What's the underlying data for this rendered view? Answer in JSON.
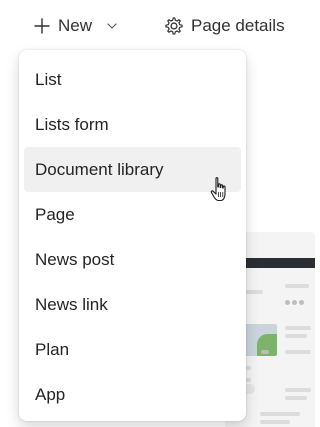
{
  "command_bar": {
    "new_label": "New",
    "details_label": "Page details",
    "icons": [
      "plus-icon",
      "chevron-down-icon",
      "gear-icon"
    ]
  },
  "menu": {
    "items": [
      {
        "label": "List"
      },
      {
        "label": "Lists form"
      },
      {
        "label": "Document library",
        "hovered": true
      },
      {
        "label": "Page"
      },
      {
        "label": "News post"
      },
      {
        "label": "News link"
      },
      {
        "label": "Plan"
      },
      {
        "label": "App"
      }
    ]
  },
  "colors": {
    "menu_background": "#ffffff",
    "hover_background": "#f0f0f0",
    "text": "#242424"
  }
}
